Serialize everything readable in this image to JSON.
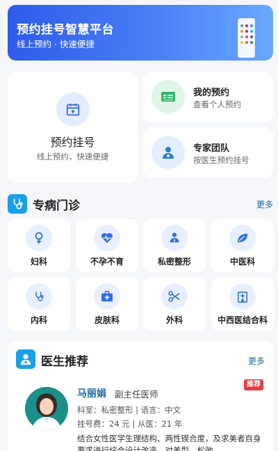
{
  "banner": {
    "title": "预约挂号智慧平台",
    "subtitle": "线上预约 · 快速便捷"
  },
  "quick_actions": {
    "main": {
      "title": "预约挂号",
      "subtitle": "线上预约，快速便捷",
      "icon": "calendar-icon"
    },
    "my_appointments": {
      "title": "我的预约",
      "subtitle": "查看个人预约",
      "icon": "id-card-icon",
      "color": "#2fb36b"
    },
    "expert_team": {
      "title": "专家团队",
      "subtitle": "按医生预约挂号",
      "icon": "doctor-icon",
      "color": "#2f7ad9"
    }
  },
  "clinics": {
    "title": "专病门诊",
    "more": "更多",
    "items": [
      {
        "label": "妇科",
        "icon": "female-icon"
      },
      {
        "label": "不孕不育",
        "icon": "heartbeat-icon"
      },
      {
        "label": "私密整形",
        "icon": "people-icon"
      },
      {
        "label": "中医科",
        "icon": "leaf-icon"
      },
      {
        "label": "内科",
        "icon": "stethoscope-icon"
      },
      {
        "label": "皮肤科",
        "icon": "medical-kit-icon"
      },
      {
        "label": "外科",
        "icon": "scissors-icon"
      },
      {
        "label": "中西医结合科",
        "icon": "hospital-icon"
      }
    ]
  },
  "doctors": {
    "title": "医生推荐",
    "more": "更多",
    "featured": {
      "name": "马丽娟",
      "position": "副主任医师",
      "badge": "推荐",
      "department_line": "科室：私密整形 | 语言：中文",
      "fee_line": "挂号费：24 元 | 从医：21 年",
      "description": "结合女性医学生理结构、两性锲合度，及求美者自身要求进行综合设计改造，对美型、松弛"
    }
  },
  "colors": {
    "accent": "#1aa0e8",
    "banner_start": "#2f5bea",
    "banner_end": "#69a8ff",
    "badge": "#e53e3e"
  }
}
